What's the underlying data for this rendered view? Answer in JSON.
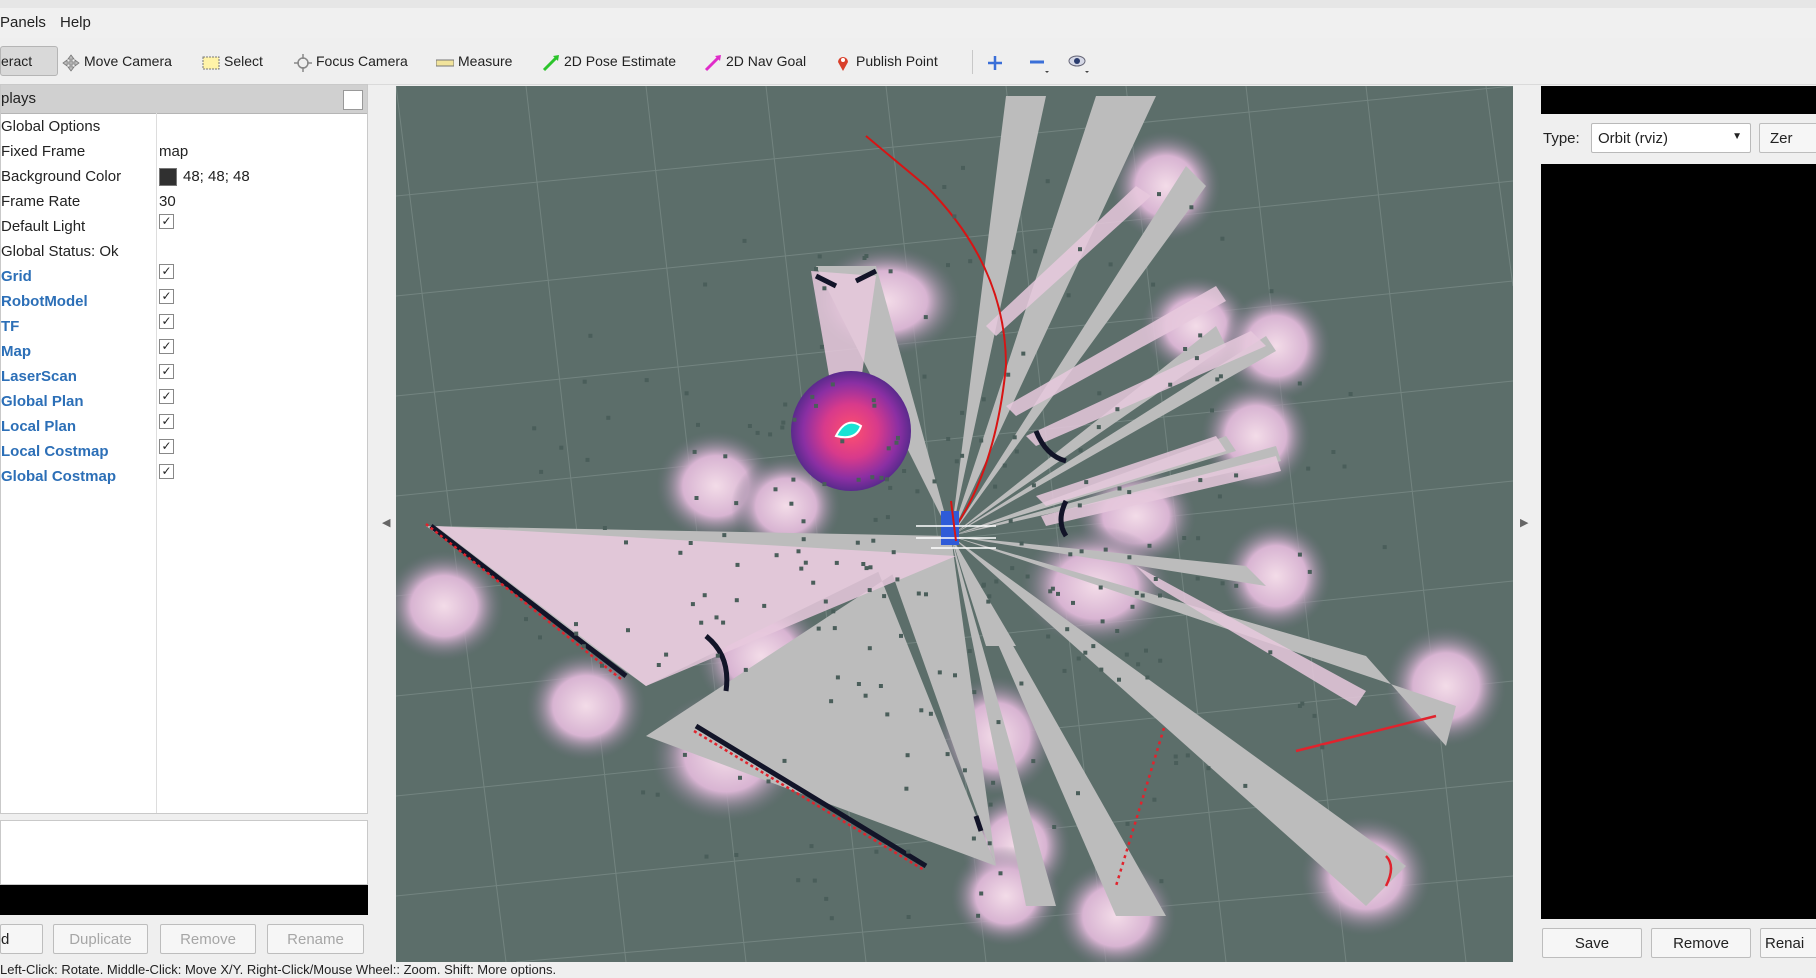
{
  "menu": {
    "panels": "Panels",
    "help": "Help"
  },
  "toolbar": {
    "interact": "eract",
    "move_camera": "Move Camera",
    "select": "Select",
    "focus_camera": "Focus Camera",
    "measure": "Measure",
    "pose_estimate": "2D Pose Estimate",
    "nav_goal": "2D Nav Goal",
    "publish_point": "Publish Point"
  },
  "displays": {
    "header": "plays",
    "rows": [
      {
        "label": "Global Options",
        "value": "",
        "checked": false,
        "plugin": false
      },
      {
        "label": "Fixed Frame",
        "value": "map",
        "checked": false,
        "plugin": false
      },
      {
        "label": "Background Color",
        "value": "48; 48; 48",
        "checked": false,
        "plugin": false
      },
      {
        "label": "Frame Rate",
        "value": "30",
        "checked": false,
        "plugin": false
      },
      {
        "label": "Default Light",
        "value": "",
        "checked": true,
        "plugin": false
      },
      {
        "label": "Global Status: Ok",
        "value": "",
        "checked": false,
        "plugin": false
      },
      {
        "label": "Grid",
        "value": "",
        "checked": true,
        "plugin": true
      },
      {
        "label": "RobotModel",
        "value": "",
        "checked": true,
        "plugin": true
      },
      {
        "label": "TF",
        "value": "",
        "checked": true,
        "plugin": true
      },
      {
        "label": "Map",
        "value": "",
        "checked": true,
        "plugin": true
      },
      {
        "label": "LaserScan",
        "value": "",
        "checked": true,
        "plugin": true
      },
      {
        "label": "Global Plan",
        "value": "",
        "checked": true,
        "plugin": true
      },
      {
        "label": "Local Plan",
        "value": "",
        "checked": true,
        "plugin": true
      },
      {
        "label": "Local Costmap",
        "value": "",
        "checked": true,
        "plugin": true
      },
      {
        "label": "Global Costmap",
        "value": "",
        "checked": true,
        "plugin": true
      }
    ],
    "background_color": "#303030",
    "buttons": {
      "add": "d",
      "duplicate": "Duplicate",
      "remove": "Remove",
      "rename": "Rename"
    }
  },
  "views": {
    "type_label": "Type:",
    "type_value": "Orbit (rviz)",
    "zero": "Zer",
    "buttons": {
      "save": "Save",
      "remove": "Remove",
      "rename": "Renai"
    }
  },
  "status_bar": "Left-Click: Rotate.  Middle-Click: Move X/Y.  Right-Click/Mouse Wheel:: Zoom.  Shift: More options."
}
